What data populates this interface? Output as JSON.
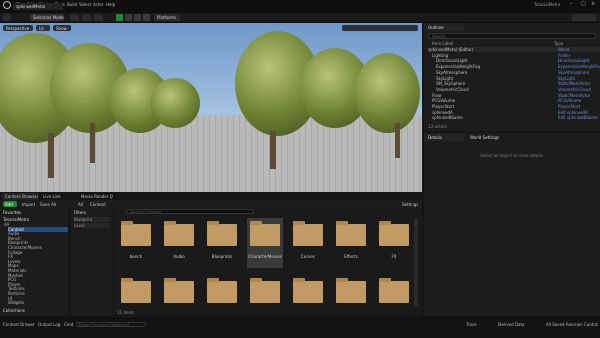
{
  "titlebar": {
    "menus": [
      "File",
      "Edit",
      "Window",
      "Tools",
      "Build",
      "Select",
      "Actor",
      "Help"
    ],
    "project": "TutorialMetro"
  },
  "level_tab": {
    "label": "sphinxedMetal"
  },
  "toolbar": {
    "mode": "Selection Mode",
    "platforms": "Platforms"
  },
  "viewport": {
    "perspective": "Perspective",
    "lit": "Lit",
    "show": "Show"
  },
  "outliner": {
    "tab": "Outliner",
    "search_placeholder": "Search",
    "columns": {
      "label": "Item Label",
      "type": "Type"
    },
    "rows": [
      {
        "name": "sphinxedMetal (Editor)",
        "type": "World",
        "indent": 0
      },
      {
        "name": "Lighting",
        "type": "Folder",
        "indent": 1
      },
      {
        "name": "DirectionalLight",
        "type": "DirectionalLight",
        "indent": 2
      },
      {
        "name": "ExponentialHeightFog",
        "type": "ExponentialHeightFog",
        "indent": 2
      },
      {
        "name": "SkyAtmosphere",
        "type": "SkyAtmosphere",
        "indent": 2
      },
      {
        "name": "SkyLight",
        "type": "SkyLight",
        "indent": 2
      },
      {
        "name": "SM_SkySphere",
        "type": "StaticMeshActor",
        "indent": 2
      },
      {
        "name": "VolumetricCloud",
        "type": "VolumetricCloud",
        "indent": 2
      },
      {
        "name": "Floor",
        "type": "StaticMeshActor",
        "indent": 1
      },
      {
        "name": "PCGVolume",
        "type": "PCGVolume",
        "indent": 1
      },
      {
        "name": "PlayerStart",
        "type": "PlayerStart",
        "indent": 1
      },
      {
        "name": "sphinxedA",
        "type": "Edit sphinxedA",
        "indent": 1
      },
      {
        "name": "sphinxedBiome",
        "type": "Edit sphinxedBiome",
        "indent": 1
      }
    ],
    "footer": "13 actors"
  },
  "details": {
    "tab": "Details",
    "tab2": "World Settings",
    "empty_msg": "Select an object to view details."
  },
  "content_browser": {
    "tabs": [
      "Content Browser",
      "Live Link",
      "Movie Render Q"
    ],
    "add": "Add",
    "import": "Import",
    "save_all": "Save All",
    "breadcrumb": [
      "All",
      "Content"
    ],
    "settings": "Settings",
    "search_placeholder": "Search Content",
    "favorites": "Favorites",
    "project_name": "TutorialMetro",
    "tree": [
      "All",
      "Content",
      "Audio",
      "Bench",
      "Blueprints",
      "CharacterMovies",
      "Foliage",
      "FX",
      "Levels",
      "Maps",
      "Materials",
      "Meshes",
      "PCG",
      "Player",
      "Textures",
      "Particles",
      "UI",
      "Widgets"
    ],
    "collections": "Collections",
    "filters_title": "Filters",
    "filters": [
      "Blueprint",
      "Level"
    ],
    "folders_row1": [
      {
        "label": "bench",
        "count": ""
      },
      {
        "label": "Audio",
        "count": ""
      },
      {
        "label": "Blueprints",
        "count": ""
      },
      {
        "label": "CharacterMovies",
        "count": ""
      },
      {
        "label": "Curves",
        "count": ""
      },
      {
        "label": "Effects",
        "count": ""
      },
      {
        "label": "FX",
        "count": ""
      }
    ],
    "items_count": "31 items"
  },
  "statusbar": {
    "content_drawer": "Content Drawer",
    "output_log": "Output Log",
    "cmd": "Cmd",
    "console_placeholder": "Enter Console Command",
    "trace": "Trace",
    "derived_data": "Derived Data",
    "all_saved": "All Saved",
    "revision_control": "Revision Control"
  }
}
